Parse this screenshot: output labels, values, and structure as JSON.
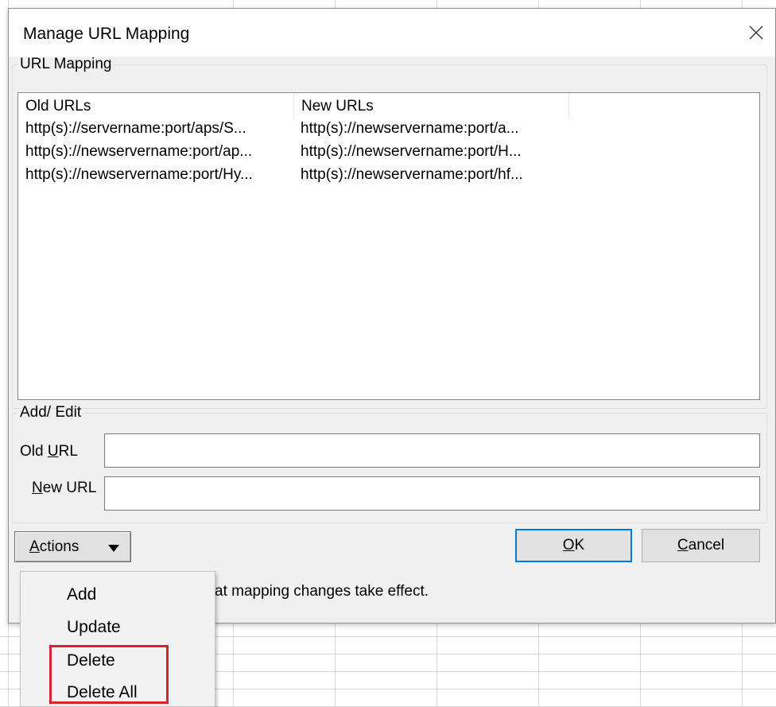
{
  "dialog": {
    "title": "Manage URL Mapping",
    "close_label": "✕"
  },
  "mapping_group": {
    "legend": "URL Mapping",
    "columns": [
      "Old URLs",
      "New URLs"
    ],
    "rows": [
      {
        "old": "http(s)://servername:port/aps/S...",
        "new": "http(s)://newservername:port/a..."
      },
      {
        "old": "http(s)://newservername:port/ap...",
        "new": "http(s)://newservername:port/H..."
      },
      {
        "old": "http(s)://newservername:port/Hy...",
        "new": "http(s)://newservername:port/hf..."
      }
    ]
  },
  "edit_group": {
    "legend": "Add/ Edit",
    "old_url_label_pre": "Old ",
    "old_url_label_mnemonic": "U",
    "old_url_label_post": "RL",
    "old_url_value": "",
    "new_url_label_mnemonic": "N",
    "new_url_label_post": "ew URL",
    "new_url_value": ""
  },
  "buttons": {
    "actions_mnemonic": "A",
    "actions_rest": "ctions",
    "ok_mnemonic": "O",
    "ok_rest": "K",
    "cancel_mnemonic": "C",
    "cancel_rest": "ancel"
  },
  "info_text": "at mapping changes take effect.",
  "actions_menu": {
    "items": [
      "Add",
      "Update",
      "Delete",
      "Delete All"
    ]
  },
  "icons": {
    "close": "close-icon",
    "caret": "caret-down-icon"
  },
  "colors": {
    "highlight": "#d9222a",
    "ok_border": "#0078d7"
  }
}
